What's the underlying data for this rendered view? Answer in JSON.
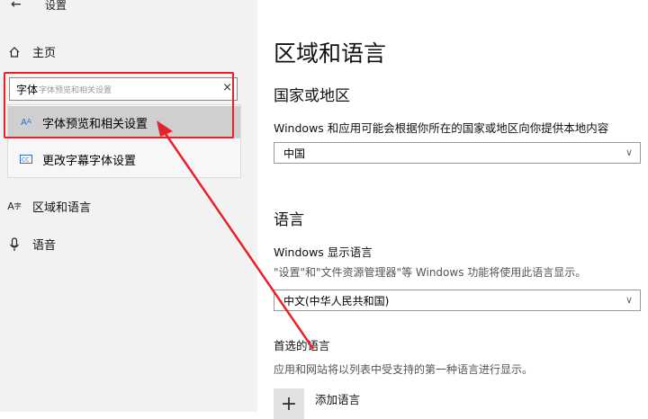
{
  "header": {
    "back_icon": "back-arrow-icon",
    "title": "设置"
  },
  "sidebar": {
    "home_label": "主页",
    "search": {
      "value": "字体",
      "ghost": "字体预览和相关设置"
    },
    "suggestions": [
      {
        "label": "字体预览和相关设置",
        "icon": "font-icon"
      },
      {
        "label": "更改字幕字体设置",
        "icon": "caption-icon"
      }
    ],
    "items": [
      {
        "label": "区域和语言",
        "icon": "region-language-icon"
      },
      {
        "label": "语音",
        "icon": "microphone-icon"
      }
    ]
  },
  "main": {
    "title": "区域和语言",
    "country": {
      "heading": "国家或地区",
      "label": "Windows 和应用可能会根据你所在的国家或地区向你提供本地内容",
      "value": "中国"
    },
    "language": {
      "heading": "语言",
      "display_label": "Windows 显示语言",
      "display_desc": "\"设置\"和\"文件资源管理器\"等 Windows 功能将使用此语言显示。",
      "display_value": "中文(中华人民共和国)",
      "preferred_label": "首选的语言",
      "preferred_desc": "应用和网站将以列表中受支持的第一种语言进行显示。",
      "add_label": "添加语言"
    }
  },
  "colors": {
    "annotation": "#e8202a",
    "sidebar_bg": "#f2f2f2",
    "selected_bg": "#cfcfcf"
  }
}
